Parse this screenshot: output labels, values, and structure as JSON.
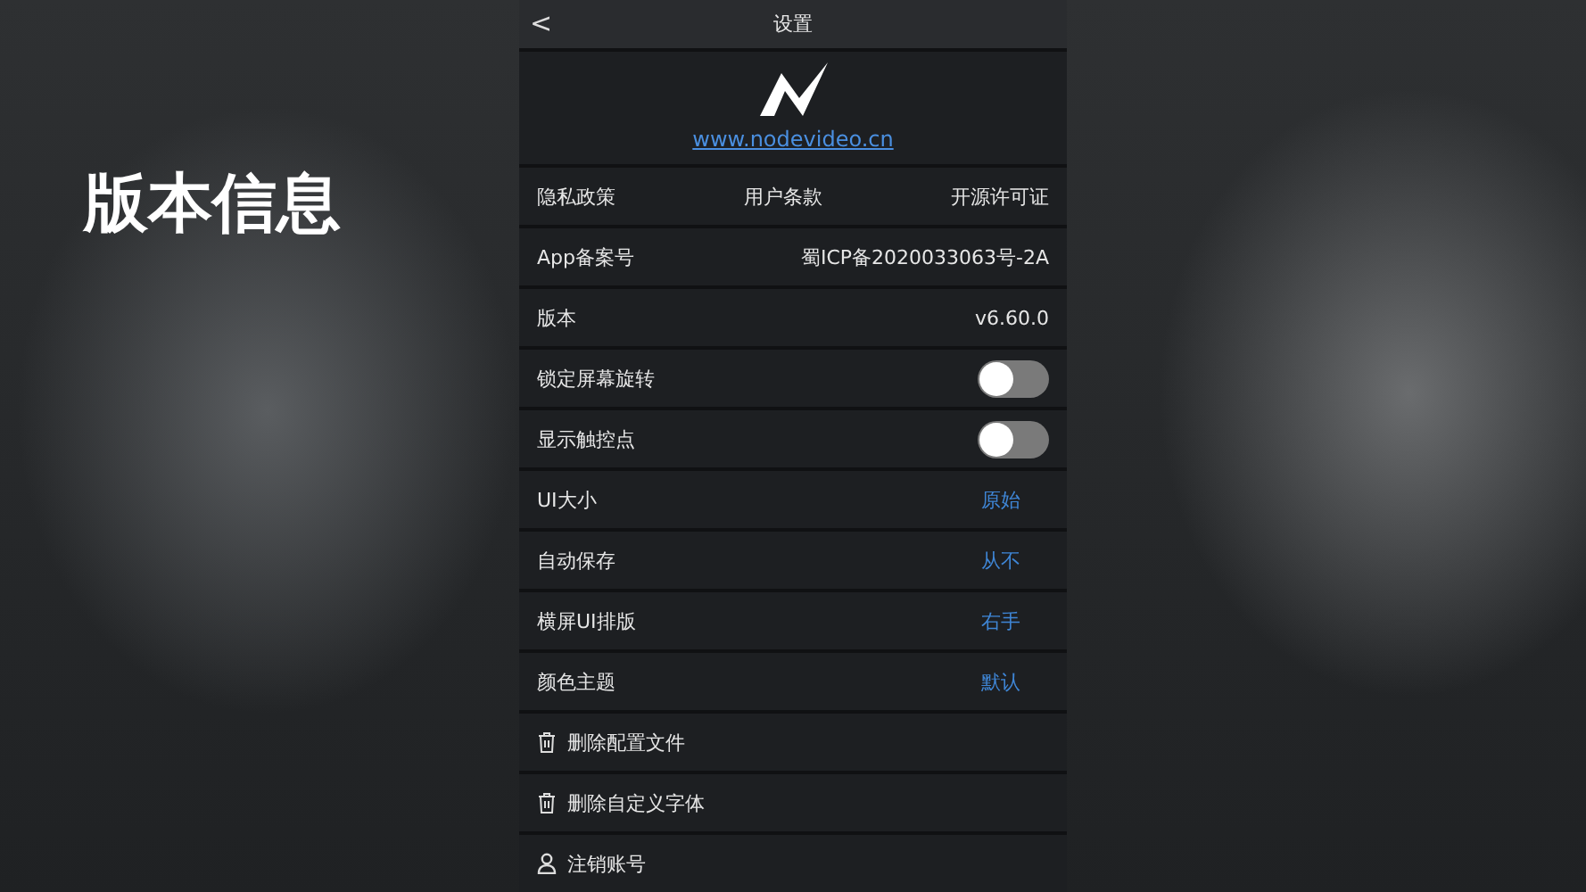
{
  "caption": "版本信息",
  "header": {
    "title": "设置",
    "back": "<"
  },
  "about": {
    "link": "www.nodevideo.cn"
  },
  "rows": [
    {
      "kind": "links",
      "links": [
        "隐私政策",
        "用户条款",
        "开源许可证"
      ]
    },
    {
      "kind": "value",
      "label": "App备案号",
      "value": "蜀ICP备2020033063号-2A"
    },
    {
      "kind": "value",
      "label": "版本",
      "value": "v6.60.0"
    },
    {
      "kind": "toggle",
      "label": "锁定屏幕旋转",
      "on": false
    },
    {
      "kind": "toggle",
      "label": "显示触控点",
      "on": false
    },
    {
      "kind": "option",
      "label": "UI大小",
      "value": "原始"
    },
    {
      "kind": "option",
      "label": "自动保存",
      "value": "从不"
    },
    {
      "kind": "option",
      "label": "横屏UI排版",
      "value": "右手"
    },
    {
      "kind": "option",
      "label": "颜色主题",
      "value": "默认"
    },
    {
      "kind": "delete",
      "label": "删除配置文件"
    },
    {
      "kind": "delete",
      "label": "删除自定义字体"
    },
    {
      "kind": "account",
      "label": "注销账号"
    }
  ]
}
